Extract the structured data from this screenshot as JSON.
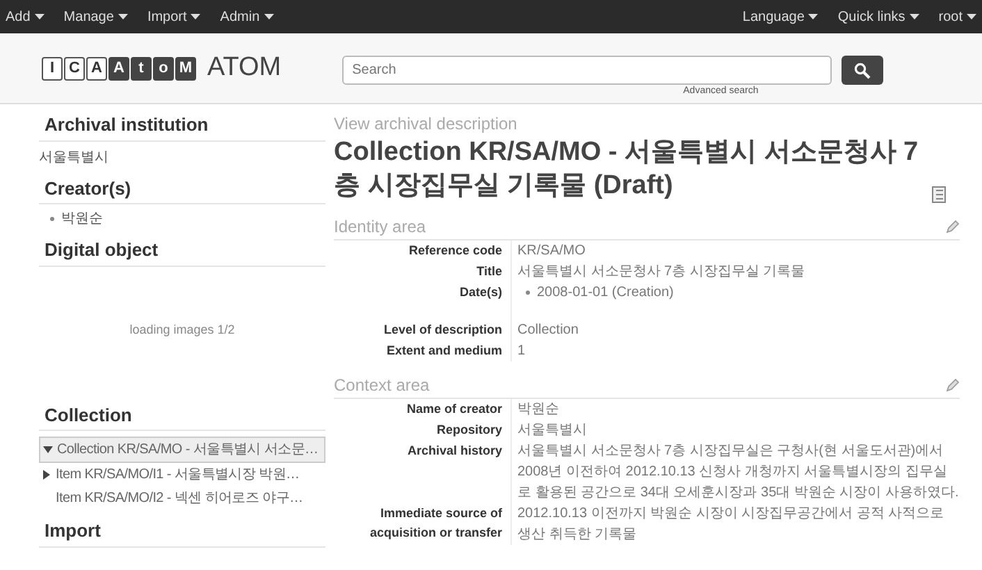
{
  "top_menu": {
    "left": [
      "Add",
      "Manage",
      "Import",
      "Admin"
    ],
    "right": [
      "Language",
      "Quick links",
      "root"
    ]
  },
  "header": {
    "logo_letters": [
      {
        "char": "I",
        "inverted": false
      },
      {
        "char": "C",
        "inverted": false
      },
      {
        "char": "A",
        "inverted": false
      },
      {
        "char": "A",
        "inverted": true
      },
      {
        "char": "t",
        "inverted": true
      },
      {
        "char": "o",
        "inverted": true
      },
      {
        "char": "M",
        "inverted": true
      }
    ],
    "brand": "ATOM",
    "search": {
      "placeholder": "Search"
    },
    "advanced_search": "Advanced search"
  },
  "sidebar": {
    "archival_institution": {
      "heading": "Archival institution",
      "value": "서울특별시"
    },
    "creators": {
      "heading": "Creator(s)",
      "items": [
        "박원순"
      ]
    },
    "digital_object": {
      "heading": "Digital object",
      "status": "loading images 1/2"
    },
    "collection": {
      "heading": "Collection",
      "items": [
        {
          "label": "Collection KR/SA/MO - 서울특별시 서소문…",
          "expandable": true,
          "expanded": true,
          "selected": true
        },
        {
          "label": "Item KR/SA/MO/I1 - 서울특별시장 박원…",
          "expandable": true,
          "expanded": false,
          "selected": false
        },
        {
          "label": "Item KR/SA/MO/I2 - 넥센 히어로즈 야구…",
          "expandable": false,
          "selected": false
        }
      ]
    },
    "import": {
      "heading": "Import"
    }
  },
  "main": {
    "breadcrumb": "View archival description",
    "title": "Collection KR/SA/MO - 서울특별시 서소문청사 7층 시장집무실 기록물 (Draft)",
    "sections": [
      {
        "heading": "Identity area",
        "fields": [
          {
            "label": "Reference code",
            "value": "KR/SA/MO"
          },
          {
            "label": "Title",
            "value": "서울특별시 서소문청사 7층 시장집무실 기록물"
          },
          {
            "label": "Date(s)",
            "list": [
              "2008-01-01 (Creation)"
            ]
          },
          {
            "label": "Level of description",
            "value": "Collection"
          },
          {
            "label": "Extent and medium",
            "value": "1"
          }
        ]
      },
      {
        "heading": "Context area",
        "fields": [
          {
            "label": "Name of creator",
            "value": "박원순"
          },
          {
            "label": "Repository",
            "value": "서울특별시"
          },
          {
            "label": "Archival history",
            "value": "서울특별시 서소문청사 7층 시장집무실은 구청사(현 서울도서관)에서 2008년 이전하여 2012.10.13 신청사 개청까지 서울특별시장의 집무실로 활용된 공간으로 34대 오세훈시장과 35대 박원순 시장이 사용하였다."
          },
          {
            "label": "Immediate source of acquisition or transfer",
            "value": "2012.10.13 이전까지 박원순 시장이 시장집무공간에서 공적 사적으로 생산 취득한 기록물"
          }
        ]
      }
    ]
  }
}
